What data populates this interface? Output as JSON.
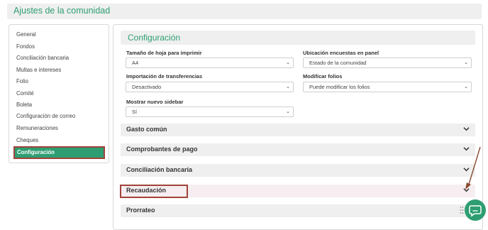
{
  "header": {
    "title": "Ajustes de la comunidad"
  },
  "sidebar": {
    "items": [
      {
        "label": "General"
      },
      {
        "label": "Fondos"
      },
      {
        "label": "Conciliación bancaria"
      },
      {
        "label": "Multas e intereses"
      },
      {
        "label": "Folio"
      },
      {
        "label": "Comité"
      },
      {
        "label": "Boleta"
      },
      {
        "label": "Configuración de correo"
      },
      {
        "label": "Remuneraciones"
      },
      {
        "label": "Cheques"
      },
      {
        "label": "Configuración",
        "active": true
      }
    ]
  },
  "main": {
    "section_title": "Configuración",
    "fields": {
      "page_size": {
        "label": "Tamaño de hoja para imprimir",
        "value": "A4"
      },
      "survey_location": {
        "label": "Ubicación encuestas en panel",
        "value": "Estado de la comunidad"
      },
      "transfer_import": {
        "label": "Importación de transferencias",
        "value": "Desactivado"
      },
      "modify_folios": {
        "label": "Modificar folios",
        "value": "Puede modificar los folios"
      },
      "new_sidebar": {
        "label": "Mostrar nuevo sidebar",
        "value": "Sí"
      }
    },
    "accordions": [
      {
        "label": "Gasto común"
      },
      {
        "label": "Comprobantes de pago"
      },
      {
        "label": "Conciliación bancaria"
      },
      {
        "label": "Recaudación"
      },
      {
        "label": "Prorrateo"
      }
    ]
  },
  "colors": {
    "accent": "#2e9e72",
    "highlight_outline": "#a0433a",
    "panel_bg": "#efefef"
  },
  "icons": {
    "accordion": "chevron-down-icon",
    "chat": "chat-bubble-icon"
  }
}
